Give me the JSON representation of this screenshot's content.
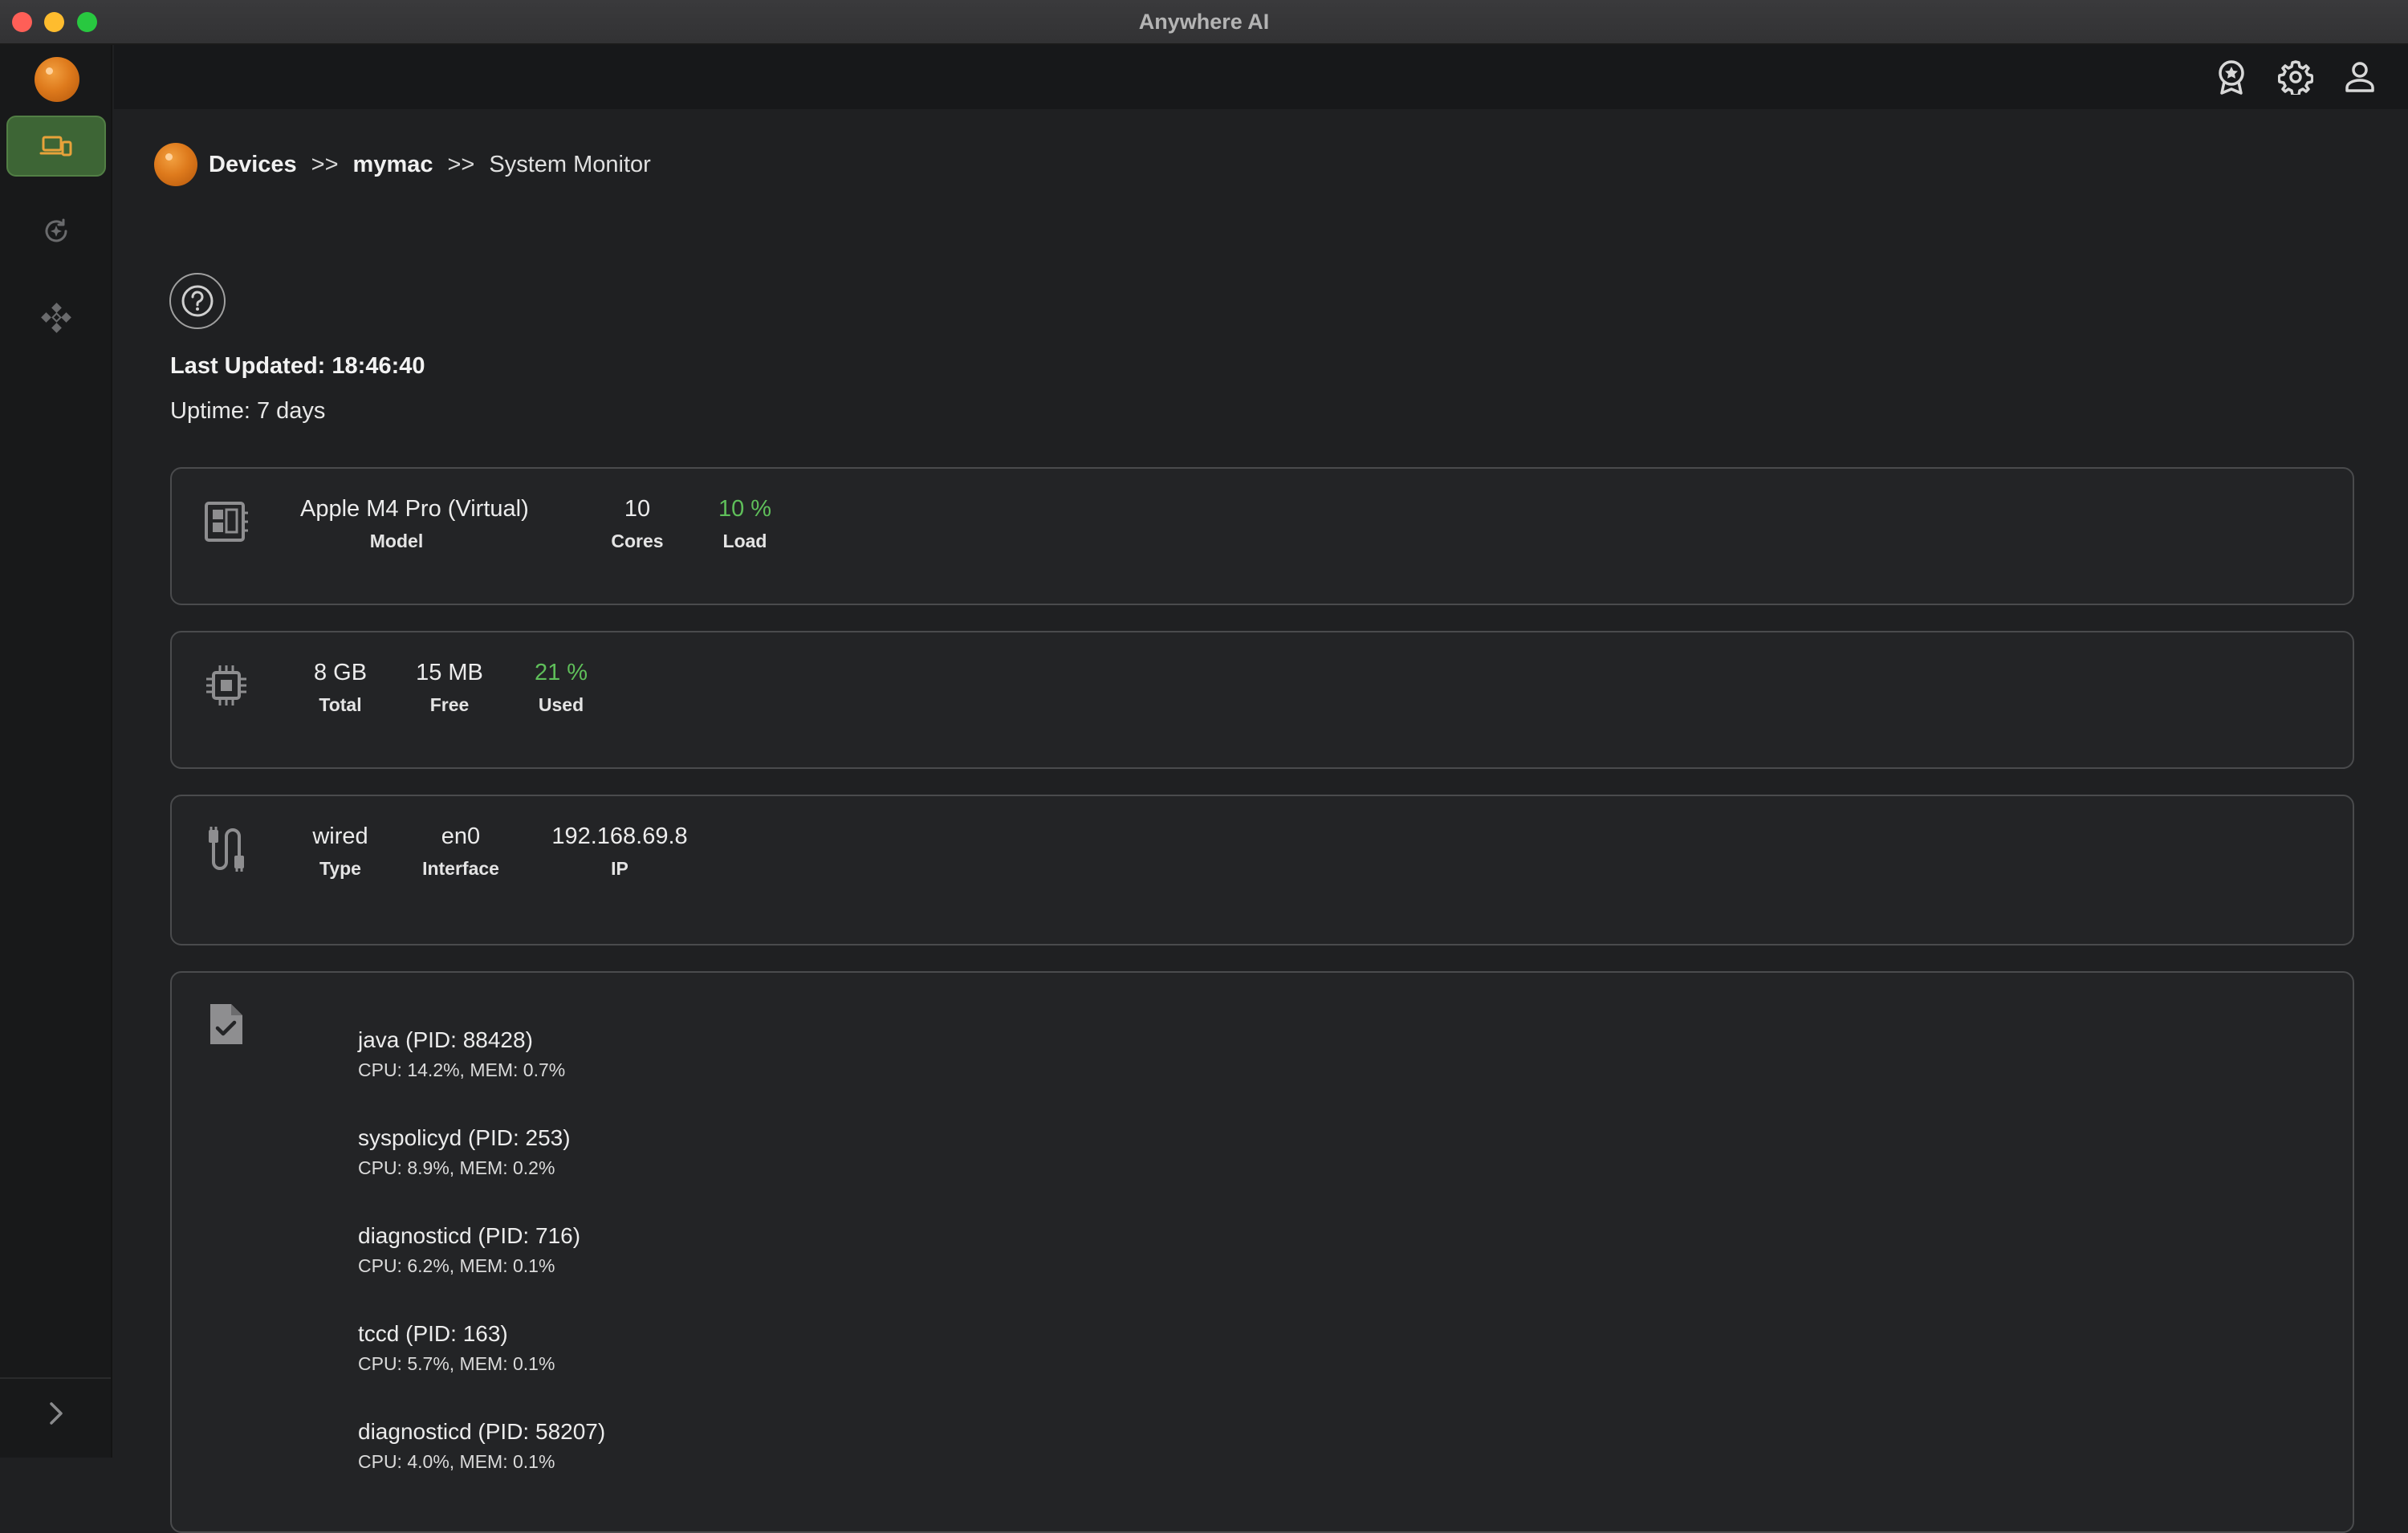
{
  "window": {
    "title": "Anywhere AI"
  },
  "breadcrumb": {
    "root": "Devices",
    "sep1": ">>",
    "device": "mymac",
    "sep2": ">>",
    "current": "System Monitor"
  },
  "status": {
    "last_updated": "Last Updated: 18:46:40",
    "uptime": "Uptime: 7 days"
  },
  "cpu": {
    "icon": "cpu-board-icon",
    "model": {
      "value": "Apple M4 Pro (Virtual)",
      "label": "Model"
    },
    "cores": {
      "value": "10",
      "label": "Cores"
    },
    "load": {
      "value": "10 %",
      "label": "Load"
    }
  },
  "memory": {
    "icon": "memory-chip-icon",
    "total": {
      "value": "8 GB",
      "label": "Total"
    },
    "free": {
      "value": "15 MB",
      "label": "Free"
    },
    "used": {
      "value": "21 %",
      "label": "Used"
    }
  },
  "network": {
    "icon": "cable-icon",
    "type": {
      "value": "wired",
      "label": "Type"
    },
    "interface": {
      "value": "en0",
      "label": "Interface"
    },
    "ip": {
      "value": "192.168.69.8",
      "label": "IP"
    }
  },
  "processes": {
    "icon": "task-file-icon",
    "items": [
      {
        "name": "java (PID: 88428)",
        "stats": "CPU: 14.2%, MEM: 0.7%"
      },
      {
        "name": "syspolicyd (PID: 253)",
        "stats": "CPU: 8.9%, MEM: 0.2%"
      },
      {
        "name": "diagnosticd (PID: 716)",
        "stats": "CPU: 6.2%, MEM: 0.1%"
      },
      {
        "name": "tccd (PID: 163)",
        "stats": "CPU: 5.7%, MEM: 0.1%"
      },
      {
        "name": "diagnosticd (PID: 58207)",
        "stats": "CPU: 4.0%, MEM: 0.1%"
      }
    ]
  },
  "colors": {
    "accent_green": "#5fbf5a",
    "nav_active": "#3d6535",
    "logo_orange": "#de7a1c"
  }
}
